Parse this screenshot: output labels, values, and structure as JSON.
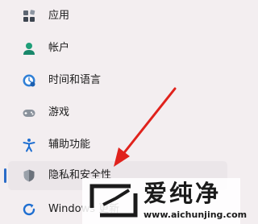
{
  "sidebar": {
    "items": [
      {
        "label": "应用",
        "icon": "apps-icon"
      },
      {
        "label": "帐户",
        "icon": "user-icon"
      },
      {
        "label": "时间和语言",
        "icon": "globe-clock-icon"
      },
      {
        "label": "游戏",
        "icon": "gamepad-icon"
      },
      {
        "label": "辅助功能",
        "icon": "accessibility-icon"
      },
      {
        "label": "隐私和安全性",
        "icon": "shield-icon",
        "selected": true
      },
      {
        "label": "Windows 更新",
        "icon": "windows-update-icon"
      }
    ]
  },
  "watermark": {
    "text": "爱纯净",
    "url": "www.aichunjing.com"
  },
  "colors": {
    "background": "#f3eef0",
    "selected_bg": "#ebe6e9",
    "accent": "#2a6cc8",
    "arrow": "#e0221c"
  }
}
